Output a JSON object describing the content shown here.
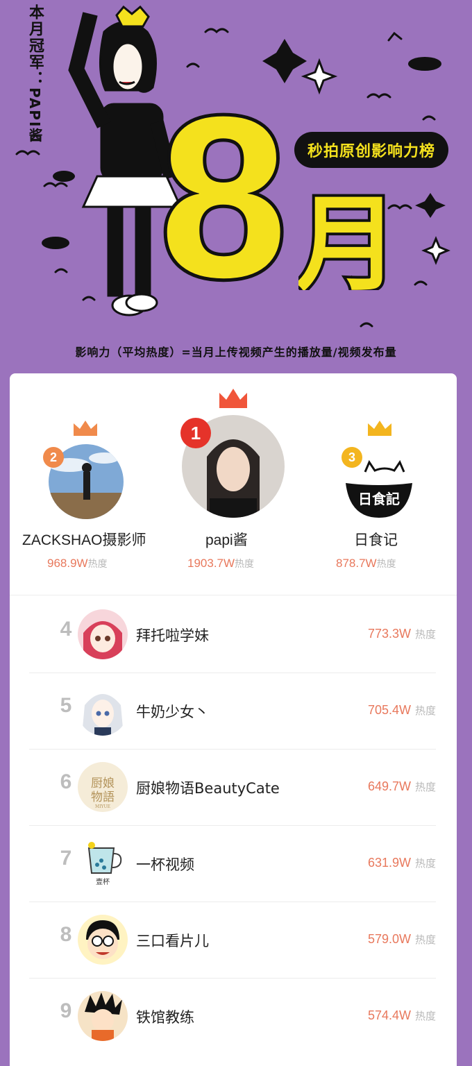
{
  "header": {
    "champion_label": "本月冠军：",
    "champion_name": "PAPI酱",
    "month_number": "8",
    "month_char": "月",
    "ribbon_title": "秒拍原创影响力榜",
    "formula": "影响力（平均热度）=当月上传视频产生的播放量/视频发布量"
  },
  "podium": [
    {
      "rank": "2",
      "name": "ZACKSHAO摄影师",
      "heat": "968.9W",
      "unit": "热度",
      "badge_color": "#f08a4b",
      "crown_color": "#f08a4b"
    },
    {
      "rank": "1",
      "name": "papi酱",
      "heat": "1903.7W",
      "unit": "热度",
      "badge_color": "#e5332a",
      "crown_color": "#f0553a"
    },
    {
      "rank": "3",
      "name": "日食记",
      "heat": "878.7W",
      "unit": "热度",
      "badge_color": "#f3b51f",
      "crown_color": "#f3b51f"
    }
  ],
  "list": [
    {
      "rank": "4",
      "name": "拜托啦学妹",
      "heat": "773.3W",
      "unit": "热度"
    },
    {
      "rank": "5",
      "name": "牛奶少女丶",
      "heat": "705.4W",
      "unit": "热度"
    },
    {
      "rank": "6",
      "name": "厨娘物语BeautyCate",
      "heat": "649.7W",
      "unit": "热度",
      "avatar_text": "厨娘物語",
      "avatar_subtext": "MIYUE"
    },
    {
      "rank": "7",
      "name": "一杯视频",
      "heat": "631.9W",
      "unit": "热度",
      "avatar_text": "壹杯"
    },
    {
      "rank": "8",
      "name": "三口看片儿",
      "heat": "579.0W",
      "unit": "热度"
    },
    {
      "rank": "9",
      "name": "铁馆教练",
      "heat": "574.4W",
      "unit": "热度"
    }
  ],
  "podium_avatar_3_text": "日食記"
}
